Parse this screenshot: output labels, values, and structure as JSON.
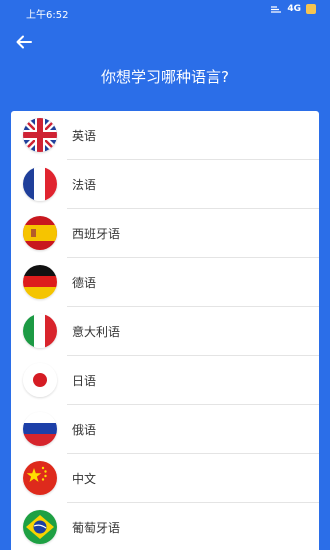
{
  "status_bar": {
    "time": "上午6:52",
    "network": "4G"
  },
  "header": {
    "title": "你想学习哪种语言?"
  },
  "languages": [
    {
      "label": "英语"
    },
    {
      "label": "法语"
    },
    {
      "label": "西班牙语"
    },
    {
      "label": "德语"
    },
    {
      "label": "意大利语"
    },
    {
      "label": "日语"
    },
    {
      "label": "俄语"
    },
    {
      "label": "中文"
    },
    {
      "label": "葡萄牙语"
    }
  ]
}
